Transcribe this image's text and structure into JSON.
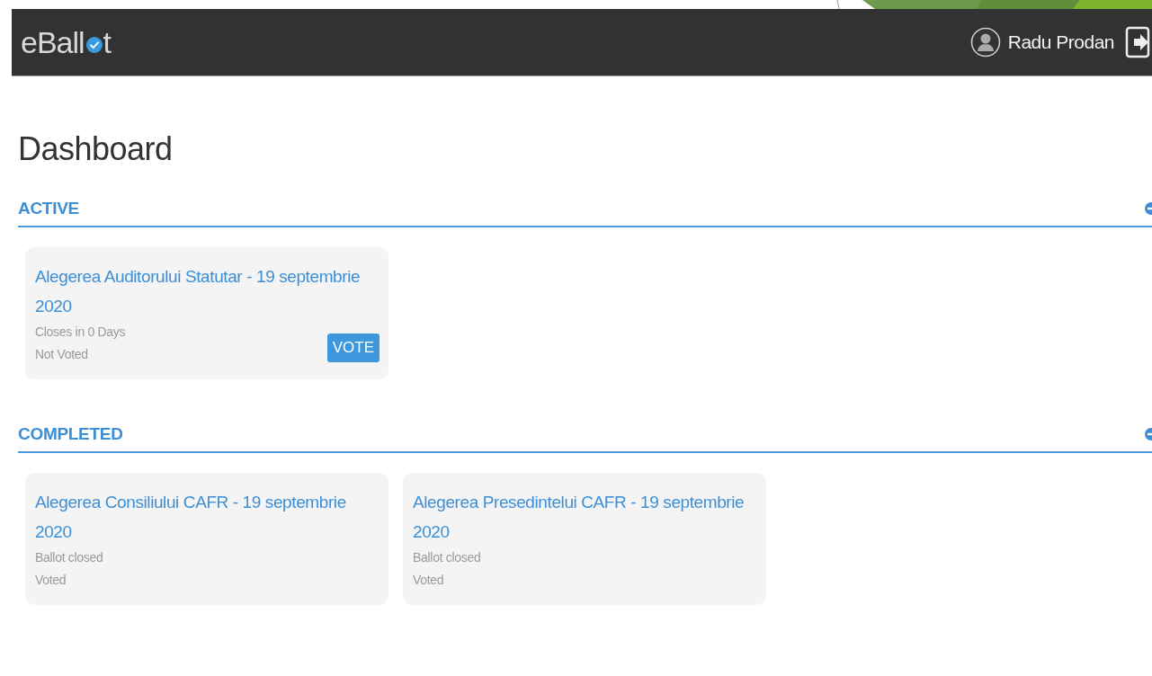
{
  "header": {
    "logo_before": "eBall",
    "logo_after": "t",
    "user_name": "Radu Prodan"
  },
  "page_title": "Dashboard",
  "sections": [
    {
      "title": "ACTIVE",
      "expanded": true,
      "ballots": [
        {
          "title": "Alegerea Auditorului Statutar - 19 septembrie 2020",
          "status": "Closes in 0 Days",
          "vote_state": "Not Voted",
          "action": "VOTE"
        }
      ]
    },
    {
      "title": "COMPLETED",
      "expanded": true,
      "ballots": [
        {
          "title": "Alegerea Consiliului CAFR - 19 septembrie 2020",
          "status": "Ballot closed",
          "vote_state": "Voted"
        },
        {
          "title": "Alegerea Presedintelui CAFR - 19 septembrie 2020",
          "status": "Ballot closed",
          "vote_state": "Voted"
        }
      ]
    }
  ]
}
